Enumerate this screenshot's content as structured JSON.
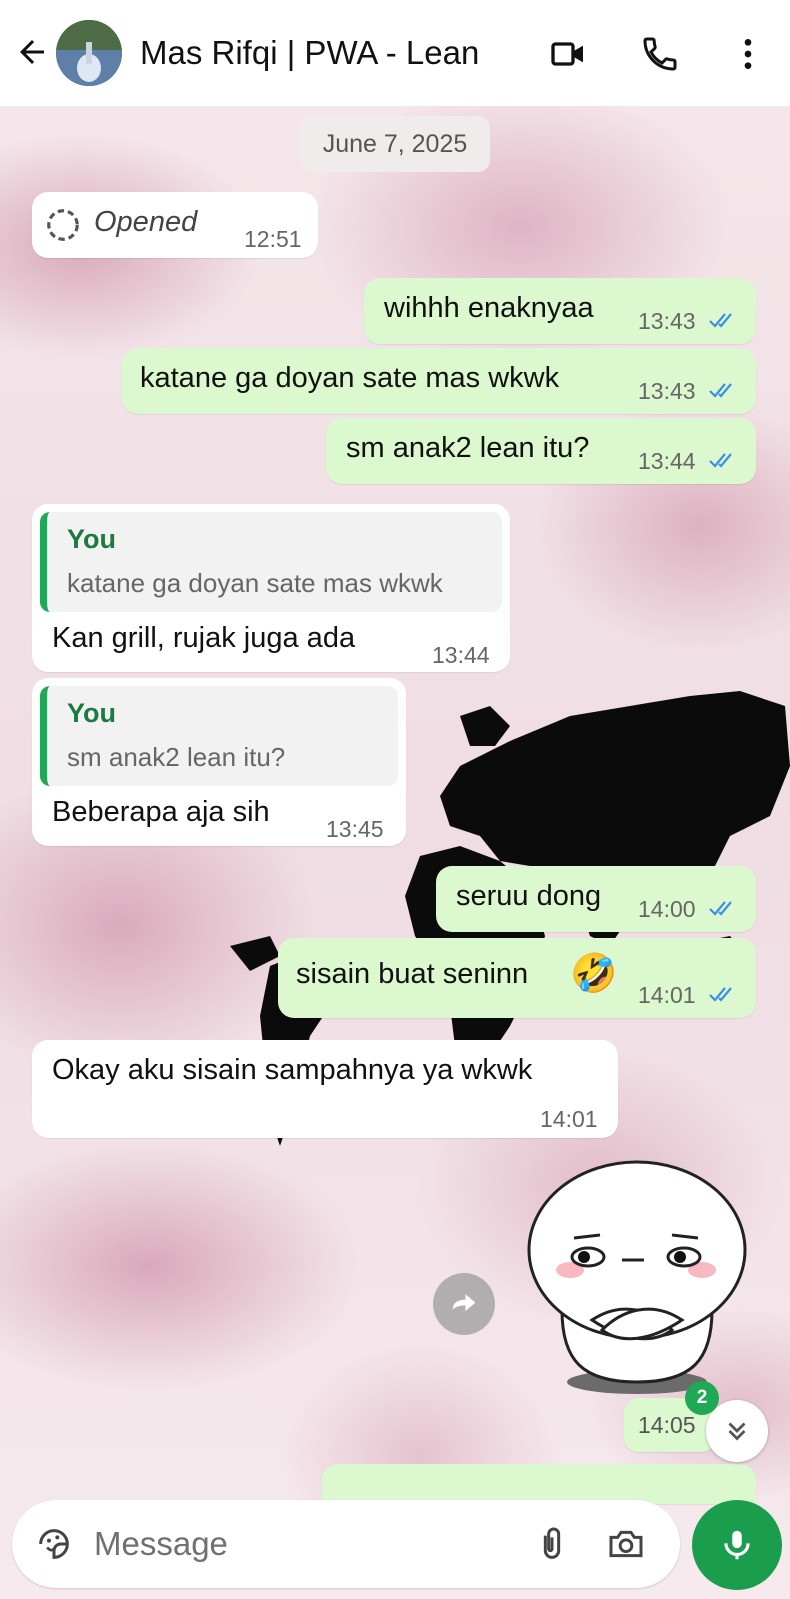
{
  "header": {
    "contact_name": "Mas Rifqi | PWA - Lean",
    "back_icon": "arrow-left-icon",
    "video_icon": "video-camera-icon",
    "call_icon": "phone-icon",
    "menu_icon": "more-vertical-icon"
  },
  "date_separator": "June 7, 2025",
  "messages": [
    {
      "direction": "in",
      "text": "Opened",
      "time": "12:51",
      "kind": "view-once-opened"
    },
    {
      "direction": "out",
      "text": "wihhh enaknyaa",
      "time": "13:43",
      "status": "read"
    },
    {
      "direction": "out",
      "text": "katane ga doyan sate mas wkwk",
      "time": "13:43",
      "status": "read"
    },
    {
      "direction": "out",
      "text": "sm anak2 lean itu?",
      "time": "13:44",
      "status": "read"
    },
    {
      "direction": "in",
      "quote_author": "You",
      "quote_text": "katane ga doyan sate mas wkwk",
      "text": "Kan grill, rujak juga ada",
      "time": "13:44"
    },
    {
      "direction": "in",
      "quote_author": "You",
      "quote_text": "sm anak2 lean itu?",
      "text": "Beberapa aja sih",
      "time": "13:45"
    },
    {
      "direction": "out",
      "text": "seruu dong",
      "time": "14:00",
      "status": "read"
    },
    {
      "direction": "out",
      "text": "sisain buat seninn",
      "emoji": "🤣",
      "time": "14:01",
      "status": "read"
    },
    {
      "direction": "in",
      "text": "Okay aku sisain sampahnya ya wkwk",
      "time": "14:01"
    },
    {
      "direction": "out",
      "kind": "sticker",
      "time": "14:05",
      "status": "read"
    }
  ],
  "unread_count": "2",
  "composer": {
    "placeholder": "Message",
    "sticker_icon": "sticker-icon",
    "attach_icon": "paperclip-icon",
    "camera_icon": "camera-icon",
    "mic_icon": "microphone-icon"
  },
  "colors": {
    "outgoing_bubble": "#dbf8cf",
    "incoming_bubble": "#ffffff",
    "accent_green": "#1a9e4e",
    "read_ticks": "#3b8fe0"
  }
}
